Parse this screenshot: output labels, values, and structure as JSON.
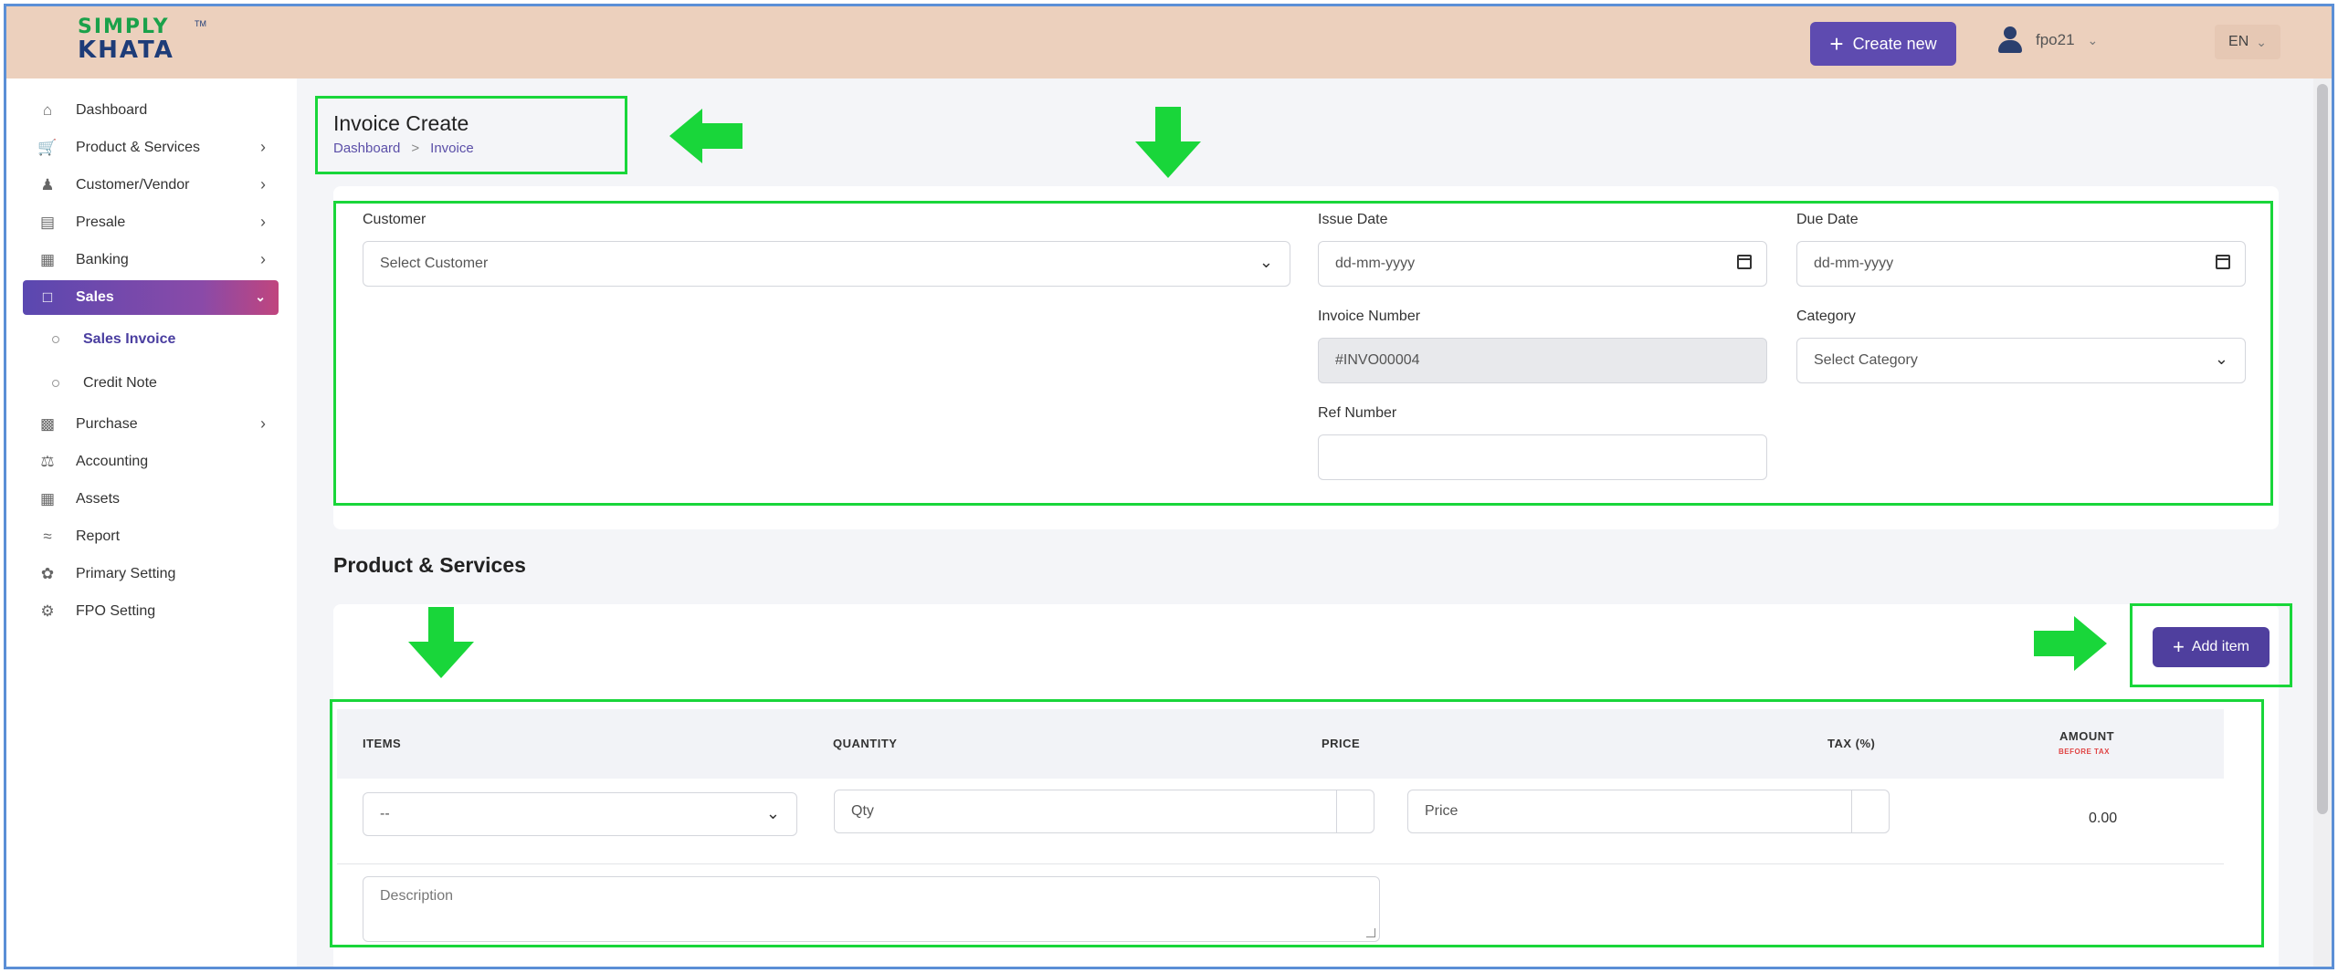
{
  "brand": {
    "line1": "SIMPLY",
    "line2": "KHATA",
    "tm": "TM"
  },
  "topbar": {
    "create_new_label": "Create new",
    "user_name": "fpo21",
    "language": "EN"
  },
  "sidebar": {
    "items": [
      {
        "label": "Dashboard",
        "icon": "home-icon",
        "has_arrow": false
      },
      {
        "label": "Product & Services",
        "icon": "cart-icon",
        "has_arrow": true
      },
      {
        "label": "Customer/Vendor",
        "icon": "user-plus-icon",
        "has_arrow": true
      },
      {
        "label": "Presale",
        "icon": "building-icon",
        "has_arrow": true
      },
      {
        "label": "Banking",
        "icon": "bank-icon",
        "has_arrow": true
      },
      {
        "label": "Sales",
        "icon": "document-icon",
        "has_arrow": true,
        "active": true
      },
      {
        "label": "Purchase",
        "icon": "clipboard-icon",
        "has_arrow": true
      },
      {
        "label": "Accounting",
        "icon": "scale-icon",
        "has_arrow": false
      },
      {
        "label": "Assets",
        "icon": "calculator-icon",
        "has_arrow": false
      },
      {
        "label": "Report",
        "icon": "chart-icon",
        "has_arrow": false
      },
      {
        "label": "Primary Setting",
        "icon": "settings-icon",
        "has_arrow": false
      },
      {
        "label": "FPO Setting",
        "icon": "gear-icon",
        "has_arrow": false
      }
    ],
    "sales_sub": [
      {
        "label": "Sales Invoice",
        "active": true
      },
      {
        "label": "Credit Note",
        "active": false
      }
    ]
  },
  "page": {
    "title": "Invoice Create",
    "breadcrumb": [
      "Dashboard",
      "Invoice"
    ],
    "breadcrumb_sep": ">"
  },
  "form": {
    "customer_label": "Customer",
    "customer_value": "Select Customer",
    "issue_date_label": "Issue Date",
    "issue_date_placeholder": "dd-mm-yyyy",
    "due_date_label": "Due Date",
    "due_date_placeholder": "dd-mm-yyyy",
    "invoice_number_label": "Invoice Number",
    "invoice_number_value": "#INVO00004",
    "category_label": "Category",
    "category_value": "Select Category",
    "ref_number_label": "Ref Number",
    "ref_number_value": ""
  },
  "products": {
    "section_title": "Product & Services",
    "add_item_label": "Add item",
    "columns": {
      "items": "ITEMS",
      "quantity": "QUANTITY",
      "price": "PRICE",
      "tax": "TAX (%)",
      "amount": "AMOUNT",
      "amount_sub": "BEFORE TAX"
    },
    "row": {
      "item_value": "--",
      "qty_placeholder": "Qty",
      "price_placeholder": "Price",
      "amount": "0.00",
      "description_placeholder": "Description"
    }
  },
  "colors": {
    "topbar": "#ecd0bd",
    "primary": "#5e4bb0",
    "annotation": "#19d63a",
    "frame": "#5b8fd6"
  }
}
